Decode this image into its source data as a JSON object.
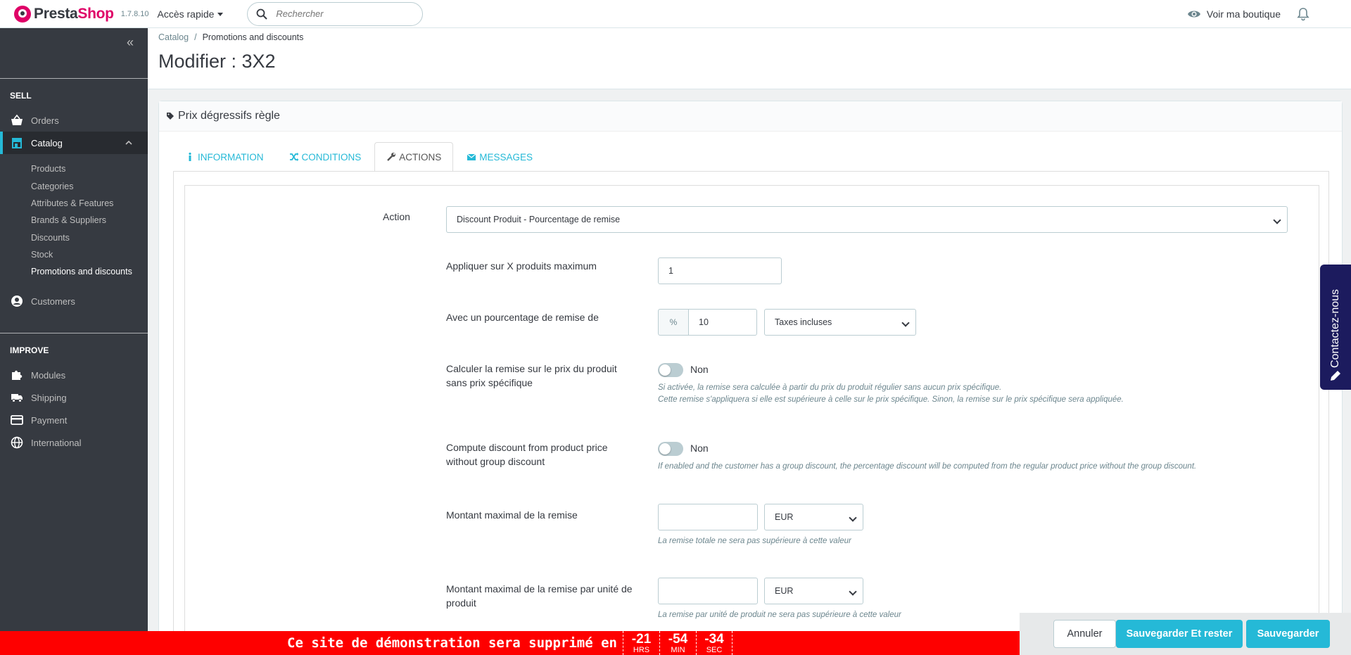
{
  "header": {
    "brand_prefix": "Presta",
    "brand_suffix": "Shop",
    "version": "1.7.8.10",
    "quick_access": "Accès rapide",
    "search_placeholder": "Rechercher",
    "view_shop": "Voir ma boutique"
  },
  "sidebar": {
    "sell_title": "SELL",
    "improve_title": "IMPROVE",
    "orders": "Orders",
    "catalog": "Catalog",
    "catalog_sub": [
      "Products",
      "Categories",
      "Attributes & Features",
      "Brands & Suppliers",
      "Discounts",
      "Stock",
      "Promotions and discounts"
    ],
    "customers": "Customers",
    "modules": "Modules",
    "shipping": "Shipping",
    "payment": "Payment",
    "international": "International"
  },
  "breadcrumb": {
    "parent": "Catalog",
    "separator": "/",
    "current": "Promotions and discounts"
  },
  "page_title": "Modifier : 3X2",
  "panel": {
    "title": "Prix dégressifs règle",
    "tabs": [
      "INFORMATION",
      "CONDITIONS",
      "ACTIONS",
      "MESSAGES"
    ]
  },
  "form": {
    "action_label": "Action",
    "action_value": "Discount Produit - Pourcentage de remise",
    "max_products_label": "Appliquer sur X produits maximum",
    "max_products_value": "1",
    "percent_label": "Avec un pourcentage de remise de",
    "percent_addon": "%",
    "percent_value": "10",
    "tax_value": "Taxes incluses",
    "specific_label": "Calculer la remise sur le prix du produit sans prix spécifique",
    "specific_toggle": "Non",
    "specific_help_1": "Si activée, la remise sera calculée à partir du prix du produit régulier sans aucun prix spécifique.",
    "specific_help_2": "Cette remise s'appliquera si elle est supérieure à celle sur le prix spécifique. Sinon, la remise sur le prix spécifique sera appliquée.",
    "group_label": "Compute discount from product price without group discount",
    "group_toggle": "Non",
    "group_help": "If enabled and the customer has a group discount, the percentage discount will be computed from the regular product price without the group discount.",
    "max_amount_label": "Montant maximal de la remise",
    "max_amount_currency": "EUR",
    "max_amount_help": "La remise totale ne sera pas supérieure à cette valeur",
    "max_unit_label": "Montant maximal de la remise par unité de produit",
    "max_unit_currency": "EUR",
    "max_unit_help": "La remise par unité de produit ne sera pas supérieure à cette valeur"
  },
  "contact": "Contactez-nous",
  "actions": {
    "cancel": "Annuler",
    "save_stay": "Sauvegarder Et rester",
    "save": "Sauvegarder"
  },
  "demo": {
    "text": "Ce site de démonstration sera supprimé en",
    "hours": "-21",
    "hours_unit": "HRS",
    "minutes": "-54",
    "minutes_unit": "MIN",
    "seconds": "-34",
    "seconds_unit": "SEC"
  },
  "colors": {
    "accent": "#25b9d7",
    "brand": "#df0067",
    "sidebar": "#363a41",
    "banner": "#fe0000"
  }
}
